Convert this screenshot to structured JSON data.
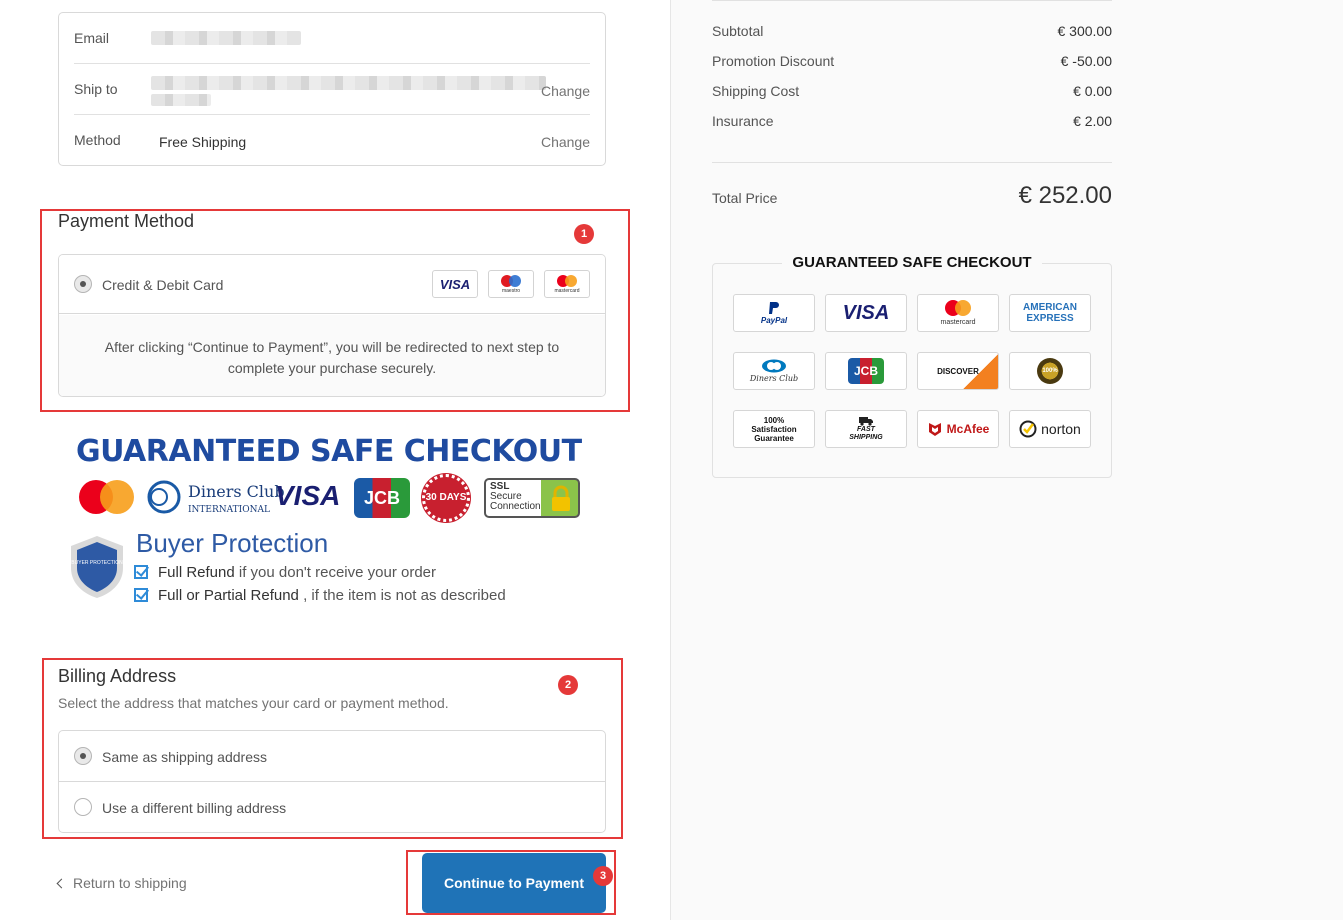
{
  "review": {
    "email_label": "Email",
    "ship_label": "Ship to",
    "ship_change": "Change",
    "method_label": "Method",
    "method_value": "Free Shipping",
    "method_change": "Change"
  },
  "payment": {
    "title": "Payment Method",
    "badge": "1",
    "option_label": "Credit & Debit Card",
    "card_icons": [
      "visa-icon",
      "maestro-icon",
      "mastercard-icon"
    ],
    "visa_text": "VISA",
    "maestro_text": "maestro",
    "mastercard_text": "mastercard",
    "note": "After clicking “Continue to Payment”, you will be redirected to next step to complete your purchase securely."
  },
  "banner": {
    "title": "GUARANTEED SAFE CHECKOUT",
    "diners_text": "Diners Club",
    "diners_sub": "INTERNATIONAL",
    "visa_text": "VISA",
    "jcb_text": "JCB",
    "days_text": "30 DAYS",
    "ssl_line1": "SSL",
    "ssl_line2": "Secure",
    "ssl_line3": "Connection",
    "shield_text": "BUYER PROTECTION",
    "bp_title": "Buyer Protection",
    "line1_bold": "Full Refund",
    "line1_rest": " if you don't receive your order",
    "line2_bold": "Full or Partial Refund",
    "line2_rest": " , if the item is not as described"
  },
  "billing": {
    "title": "Billing Address",
    "badge": "2",
    "subtitle": "Select the address that matches your card or payment method.",
    "option_same": "Same as shipping address",
    "option_different": "Use a different billing address",
    "selected": "same"
  },
  "footer": {
    "return_label": "Return to shipping",
    "continue_label": "Continue to Payment",
    "badge": "3"
  },
  "summary": {
    "rows": [
      {
        "label": "Subtotal",
        "value": "€ 300.00"
      },
      {
        "label": "Promotion Discount",
        "value": "€ -50.00"
      },
      {
        "label": "Shipping Cost",
        "value": "€ 0.00"
      },
      {
        "label": "Insurance",
        "value": "€ 2.00"
      }
    ],
    "total_label": "Total Price",
    "total_value": "€ 252.00"
  },
  "safe_checkout": {
    "title": "GUARANTEED SAFE CHECKOUT",
    "logos": [
      {
        "name": "paypal-logo",
        "text": "PayPal"
      },
      {
        "name": "visa-logo",
        "text": "VISA"
      },
      {
        "name": "mastercard-logo",
        "text": "mastercard"
      },
      {
        "name": "amex-logo",
        "text": "AMERICAN EXPRESS"
      },
      {
        "name": "diners-logo",
        "text": "Diners Club"
      },
      {
        "name": "jcb-logo",
        "text": "JCB"
      },
      {
        "name": "discover-logo",
        "text": "DISCOVER"
      },
      {
        "name": "guarantee-seal-logo",
        "text": "100%"
      },
      {
        "name": "satisfaction-logo",
        "text": "100% Satisfaction Guarantee"
      },
      {
        "name": "fast-shipping-logo",
        "text": "FAST SHIPPING"
      },
      {
        "name": "mcafee-logo",
        "text": "McAfee"
      },
      {
        "name": "norton-logo",
        "text": "norton"
      }
    ]
  },
  "colors": {
    "accent": "#1f73b7",
    "highlight": "#e53939",
    "visa_blue": "#1a1f71",
    "banner_blue": "#1f4ba0"
  }
}
